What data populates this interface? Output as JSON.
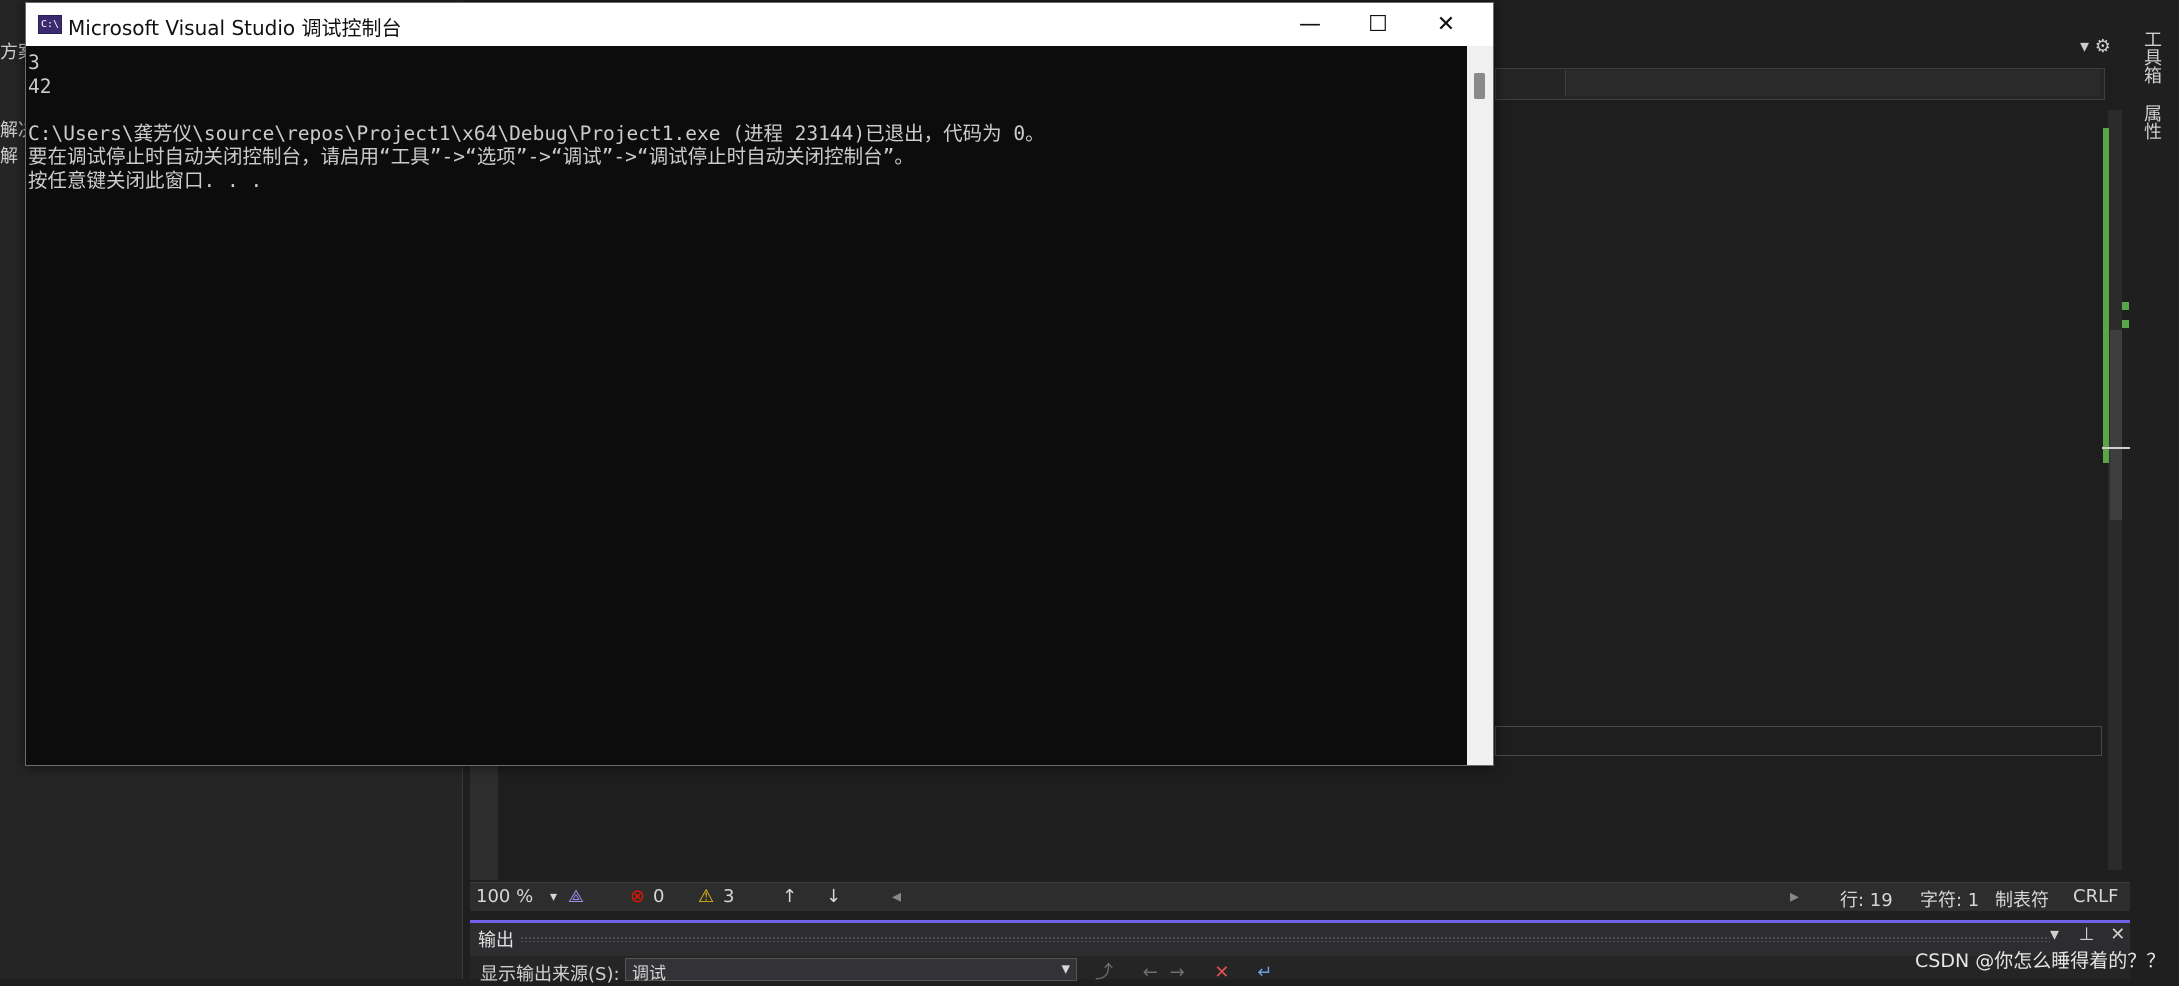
{
  "console": {
    "title": "Microsoft Visual Studio 调试控制台",
    "icon_label": "C:\\",
    "lines": [
      "3",
      "42",
      "",
      "C:\\Users\\龚芳仪\\source\\repos\\Project1\\x64\\Debug\\Project1.exe (进程 23144)已退出，代码为 0。",
      "要在调试停止时自动关闭控制台，请启用“工具”->“选项”->“调试”->“调试停止时自动关闭控制台”。",
      "按任意键关闭此窗口. . ."
    ],
    "controls": {
      "minimize": "—",
      "maximize": "☐",
      "close": "✕"
    }
  },
  "vs": {
    "left_fragments": [
      "方案",
      "",
      "",
      "解决",
      "解",
      "",
      "",
      ""
    ],
    "right_tabs": {
      "toolbox": "工具箱",
      "properties": "属性"
    },
    "statusbar": {
      "zoom": "100 %",
      "errors": "0",
      "warnings": "3",
      "line": "行: 19",
      "char": "字符: 1",
      "tab": "制表符",
      "eol": "CRLF"
    },
    "output": {
      "title": "输出",
      "source_label": "显示输出来源(S):",
      "source_value": "调试"
    },
    "top_right": "▾ ⚙"
  },
  "watermark": "CSDN @你怎么睡得着的？？",
  "colors": {
    "console_bg": "#0c0c0c",
    "console_text": "#cccccc",
    "accent_purple": "#7160e8",
    "gutter_green": "#57a64a",
    "error_red": "#e51400",
    "warning_yellow": "#f2c811"
  }
}
